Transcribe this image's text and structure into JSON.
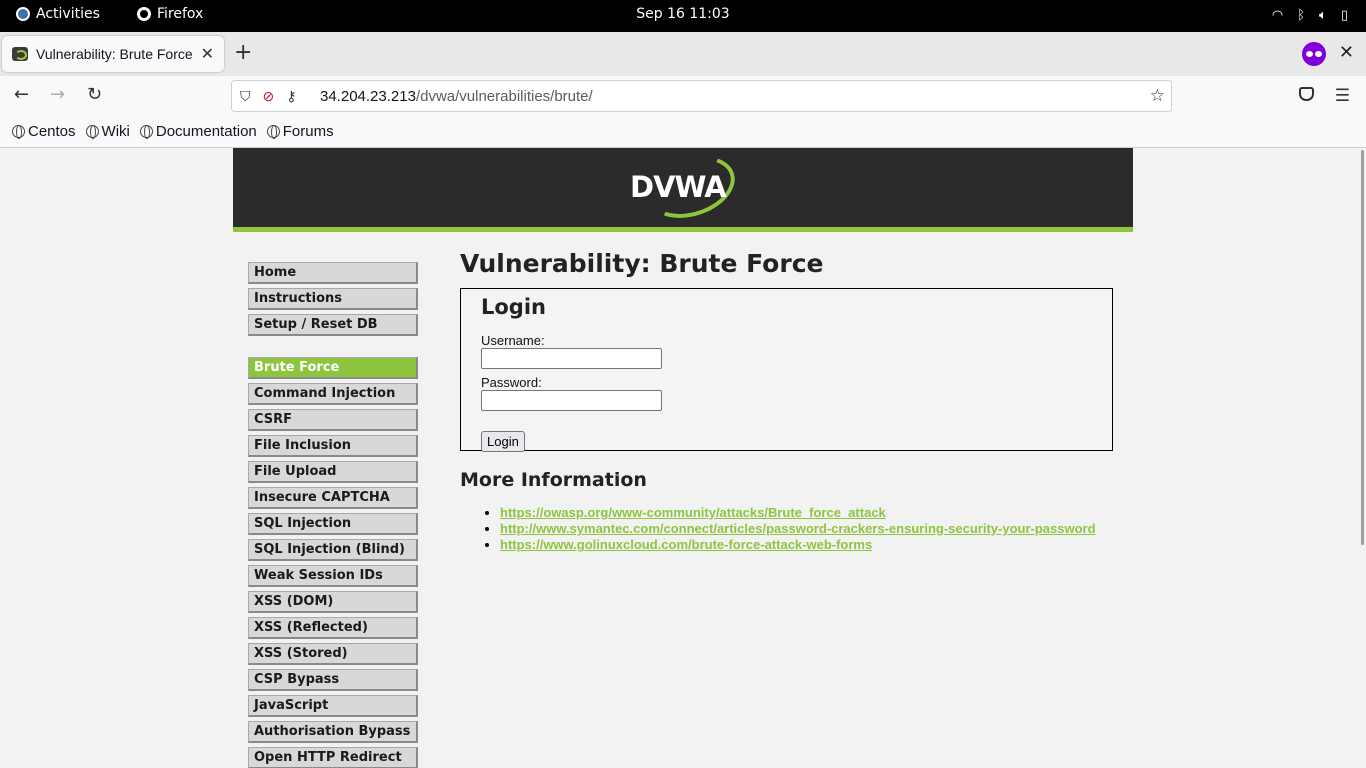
{
  "system": {
    "activities": "Activities",
    "app_name": "Firefox",
    "clock": "Sep 16  11:03"
  },
  "browser": {
    "tab_title": "Vulnerability: Brute Force",
    "url_host": "34.204.23.213",
    "url_path": "/dvwa/vulnerabilities/brute/",
    "bookmarks": [
      "Centos",
      "Wiki",
      "Documentation",
      "Forums"
    ]
  },
  "dvwa": {
    "logo_text": "DVWA",
    "menu_group1": [
      "Home",
      "Instructions",
      "Setup / Reset DB"
    ],
    "menu_group2": [
      "Brute Force",
      "Command Injection",
      "CSRF",
      "File Inclusion",
      "File Upload",
      "Insecure CAPTCHA",
      "SQL Injection",
      "SQL Injection (Blind)",
      "Weak Session IDs",
      "XSS (DOM)",
      "XSS (Reflected)",
      "XSS (Stored)",
      "CSP Bypass",
      "JavaScript",
      "Authorisation Bypass",
      "Open HTTP Redirect"
    ],
    "active_item": "Brute Force",
    "page_title": "Vulnerability: Brute Force",
    "login_heading": "Login",
    "username_label": "Username:",
    "password_label": "Password:",
    "username_value": "",
    "password_value": "",
    "login_button": "Login",
    "more_info_heading": "More Information",
    "links": [
      "https://owasp.org/www-community/attacks/Brute_force_attack",
      "http://www.symantec.com/connect/articles/password-crackers-ensuring-security-your-password",
      "https://www.golinuxcloud.com/brute-force-attack-web-forms"
    ]
  },
  "colors": {
    "accent_green": "#8dc53e",
    "header_dark": "#2b2b2b",
    "private_purple": "#8000d7"
  }
}
